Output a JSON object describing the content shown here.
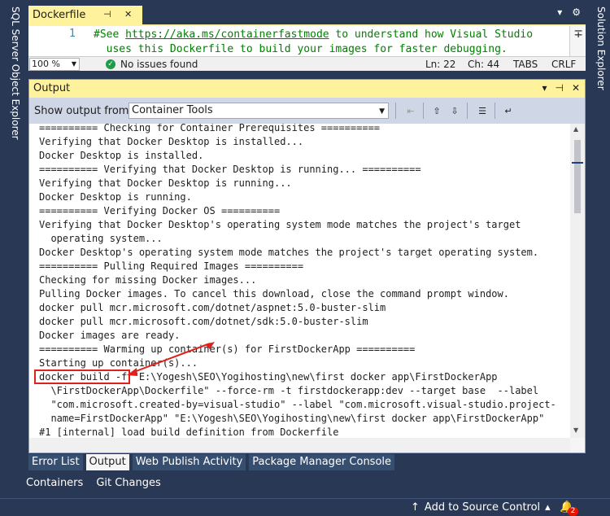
{
  "left_vertical_tab": "SQL Server Object Explorer",
  "right_vertical_tab": "Solution Explorer",
  "document_tab": {
    "title": "Dockerfile",
    "pin_icon": "pin-icon",
    "close_icon": "close-icon"
  },
  "editor": {
    "line_number": "1",
    "line1_prefix": "#See ",
    "line1_link": "https://aka.ms/containerfastmode",
    "line1_suffix": " to understand how Visual Studio",
    "line2": "uses this Dockerfile to build your images for faster debugging."
  },
  "editor_status": {
    "zoom": "100 %",
    "issues": "No issues found",
    "line": "Ln: 22",
    "col": "Ch: 44",
    "tabs": "TABS",
    "eol": "CRLF"
  },
  "output": {
    "title": "Output",
    "show_from_label": "Show output from:",
    "source": "Container Tools",
    "lines": [
      "========== Checking for Container Prerequisites ==========",
      "Verifying that Docker Desktop is installed...",
      "Docker Desktop is installed.",
      "========== Verifying that Docker Desktop is running... ==========",
      "Verifying that Docker Desktop is running...",
      "Docker Desktop is running.",
      "========== Verifying Docker OS ==========",
      "Verifying that Docker Desktop's operating system mode matches the project's target",
      "  operating system...",
      "Docker Desktop's operating system mode matches the project's target operating system.",
      "========== Pulling Required Images ==========",
      "Checking for missing Docker images...",
      "Pulling Docker images. To cancel this download, close the command prompt window.",
      "docker pull mcr.microsoft.com/dotnet/aspnet:5.0-buster-slim",
      "docker pull mcr.microsoft.com/dotnet/sdk:5.0-buster-slim",
      "Docker images are ready.",
      "========== Warming up container(s) for FirstDockerApp ==========",
      "Starting up container(s)...",
      "docker build -f \"E:\\Yogesh\\SEO\\Yogihosting\\new\\first docker app\\FirstDockerApp",
      "  \\FirstDockerApp\\Dockerfile\" --force-rm -t firstdockerapp:dev --target base  --label",
      "  \"com.microsoft.created-by=visual-studio\" --label \"com.microsoft.visual-studio.project-",
      "  name=FirstDockerApp\" \"E:\\Yogesh\\SEO\\Yogihosting\\new\\first docker app\\FirstDockerApp\"",
      "#1 [internal] load build definition from Dockerfile"
    ]
  },
  "tool_tabs": [
    "Error List",
    "Output",
    "Web Publish Activity",
    "Package Manager Console"
  ],
  "bottom_tabs": [
    "Containers",
    "Git Changes"
  ],
  "status_bar": {
    "source_control": "Add to Source Control",
    "notifications": "2"
  },
  "colors": {
    "accent": "#fff29d",
    "chrome": "#293955",
    "annotation": "#e0201a"
  }
}
